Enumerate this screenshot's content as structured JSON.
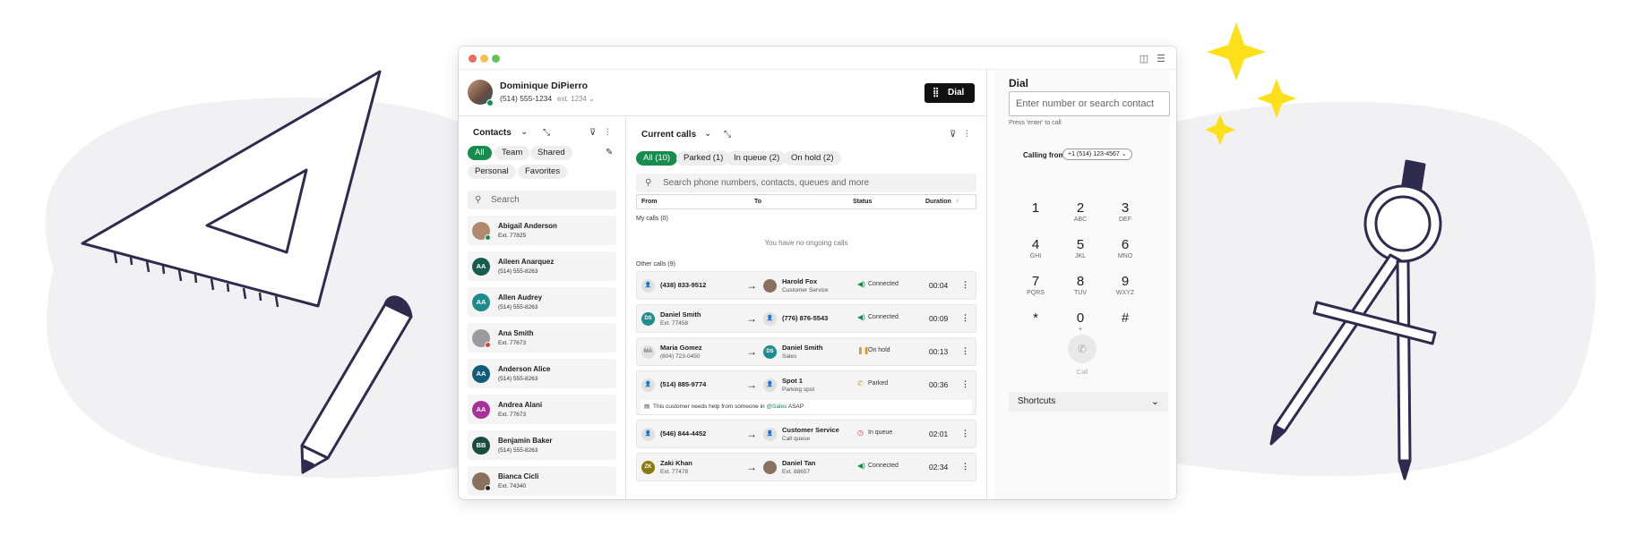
{
  "window": {
    "traffic_light_colors": [
      "#ed6a5e",
      "#f5bf4f",
      "#61c554"
    ],
    "icons": [
      "sidebar-icon",
      "settings-icon"
    ]
  },
  "agent": {
    "name": "Dominique DiPierro",
    "phone": "(514) 555-1234",
    "ext": "ext. 1234",
    "status_color": "#188c4e"
  },
  "dial_button": {
    "label": "Dial",
    "icon": "keypad-icon"
  },
  "contacts": {
    "title": "Contacts",
    "filters": [
      "All",
      "Team",
      "Shared",
      "Personal",
      "Favorites"
    ],
    "active_filter": "All",
    "search_placeholder": "Search",
    "items": [
      {
        "name": "Abigail Anderson",
        "detail": "Ext. 77825",
        "initials": "",
        "color": "#b08970",
        "photo": true,
        "status": "online"
      },
      {
        "name": "Aileen Anarquez",
        "detail": "(514) 555-8263",
        "initials": "AA",
        "color": "#155e4f"
      },
      {
        "name": "Allen Audrey",
        "detail": "(514) 555-8263",
        "initials": "AA",
        "color": "#1e8c8c"
      },
      {
        "name": "Ana Smith",
        "detail": "Ext. 77673",
        "initials": "",
        "color": "#9a9aa0",
        "photo": true,
        "status": "busy"
      },
      {
        "name": "Anderson Alice",
        "detail": "(514) 555-8263",
        "initials": "AA",
        "color": "#125c7a"
      },
      {
        "name": "Andrea Alani",
        "detail": "Ext. 77673",
        "initials": "AA",
        "color": "#a8329a"
      },
      {
        "name": "Benjamin Baker",
        "detail": "(514) 555-8263",
        "initials": "BB",
        "color": "#1b4d3e"
      },
      {
        "name": "Bianca Cicli",
        "detail": "Ext. 74340",
        "initials": "",
        "color": "#8a7060",
        "photo": true,
        "status": "offline"
      }
    ]
  },
  "calls": {
    "title": "Current calls",
    "filters": [
      "All (10)",
      "Parked (1)",
      "In queue (2)",
      "On hold (2)"
    ],
    "active_filter": "All (10)",
    "search_placeholder": "Search phone numbers, contacts, queues and more",
    "columns": [
      "From",
      "To",
      "Status",
      "Duration"
    ],
    "my_calls_label": "My calls (0)",
    "empty_text": "You have no ongoing calls",
    "other_calls_label": "Other calls (9)",
    "rows": [
      {
        "from_name": "(438) 833-9512",
        "from_detail": "",
        "from_initials": "",
        "from_color": "",
        "to_name": "Harold Fox",
        "to_detail": "Customer Service",
        "to_initials": "",
        "to_color": "#8a7060",
        "to_photo": true,
        "status": "Connected",
        "status_color": "#188c4e",
        "duration": "00:04"
      },
      {
        "from_name": "Daniel Smith",
        "from_detail": "Ext. 77458",
        "from_initials": "DS",
        "from_color": "#1e8c8c",
        "to_name": "(776) 876-5543",
        "to_detail": "",
        "to_initials": "",
        "to_color": "",
        "status": "Connected",
        "status_color": "#188c4e",
        "duration": "00:09"
      },
      {
        "from_name": "Maria Gomez",
        "from_detail": "(604) 723-0450",
        "from_initials": "MA",
        "from_color": "#d9d9d9",
        "to_name": "Daniel Smith",
        "to_detail": "Sales",
        "to_initials": "DS",
        "to_color": "#1e8c8c",
        "status": "On hold",
        "status_color": "#d99a1c",
        "duration": "00:13"
      },
      {
        "from_name": "(514) 885-9774",
        "from_detail": "",
        "from_initials": "",
        "from_color": "",
        "to_name": "Spot 1",
        "to_detail": "Parking spot",
        "to_initials": "",
        "to_color": "#777",
        "status": "Parked",
        "status_color": "#d99a1c",
        "duration": "00:36",
        "note_prefix": "This customer needs help from someone in ",
        "note_mention": "@Sales",
        "note_suffix": " ASAP"
      },
      {
        "from_name": "(546) 844-4452",
        "from_detail": "",
        "from_initials": "",
        "from_color": "",
        "to_name": "Customer Service",
        "to_detail": "Call queue",
        "to_initials": "",
        "to_color": "#777",
        "status": "In queue",
        "status_color": "#d8403a",
        "duration": "02:01"
      },
      {
        "from_name": "Zaki Khan",
        "from_detail": "Ext. 77478",
        "from_initials": "ZK",
        "from_color": "#8a7a12",
        "to_name": "Daniel Tan",
        "to_detail": "Ext. 88657",
        "to_initials": "",
        "to_color": "#8a7060",
        "to_photo": true,
        "status": "Connected",
        "status_color": "#188c4e",
        "duration": "02:34"
      }
    ]
  },
  "dial": {
    "title": "Dial",
    "input_placeholder": "Enter number or search contact",
    "hint": "Press 'enter' to call",
    "calling_from_label": "Calling from",
    "calling_from_value": "+1 (514) 123-4567",
    "keys": [
      {
        "d": "1",
        "l": ""
      },
      {
        "d": "2",
        "l": "ABC"
      },
      {
        "d": "3",
        "l": "DEF"
      },
      {
        "d": "4",
        "l": "GHI"
      },
      {
        "d": "5",
        "l": "JKL"
      },
      {
        "d": "6",
        "l": "MNO"
      },
      {
        "d": "7",
        "l": "PQRS"
      },
      {
        "d": "8",
        "l": "TUV"
      },
      {
        "d": "9",
        "l": "WXYZ"
      },
      {
        "d": "*",
        "l": ""
      },
      {
        "d": "0",
        "l": "+"
      },
      {
        "d": "#",
        "l": ""
      }
    ],
    "call_label": "Call",
    "shortcuts_label": "Shortcuts"
  },
  "decor": {
    "accent": "#fde01a",
    "ink": "#2f2b4f",
    "blob": "#f1f1f3"
  }
}
